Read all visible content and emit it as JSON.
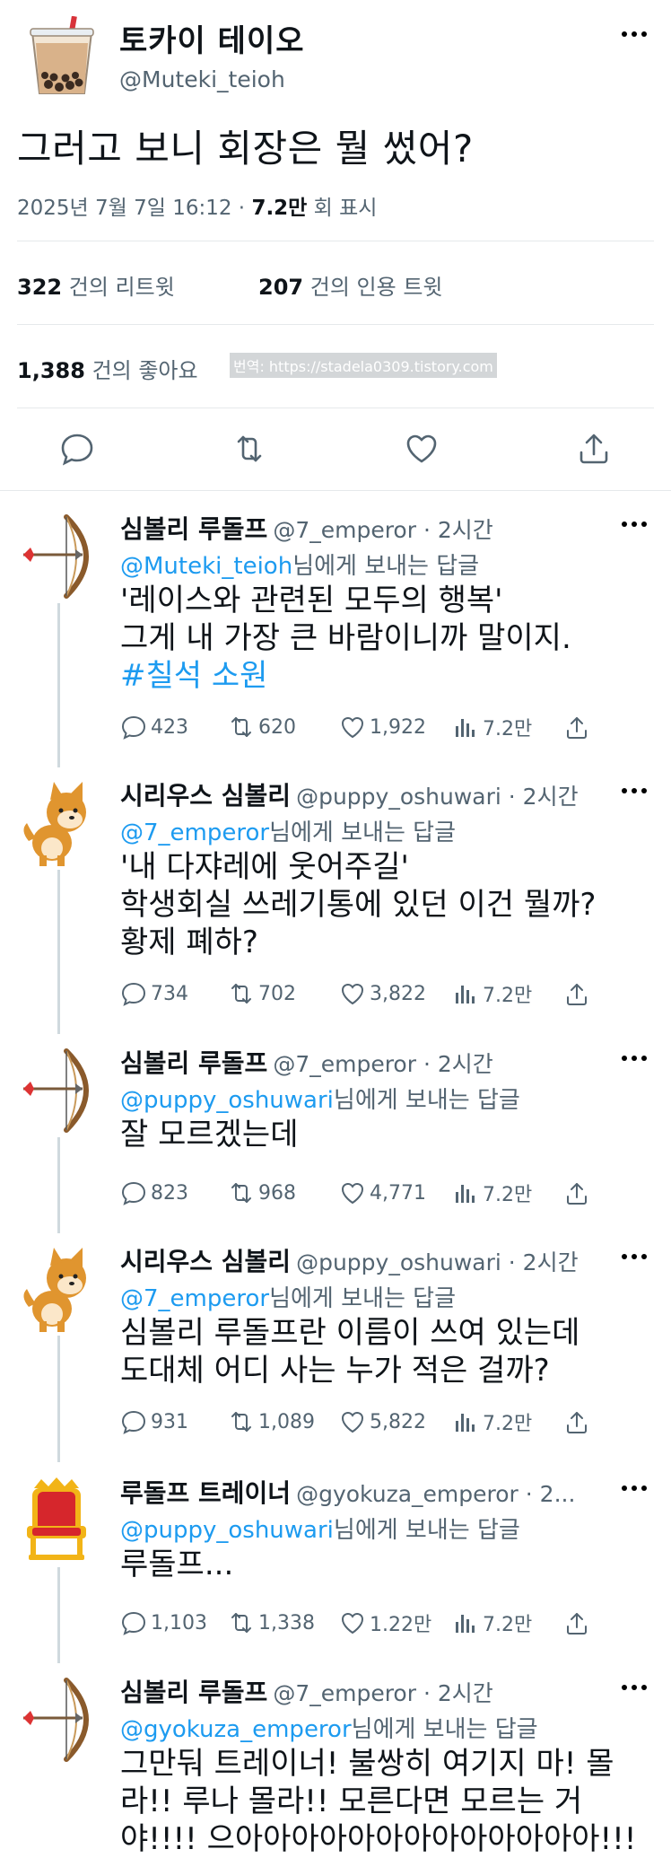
{
  "main_tweet": {
    "name": "토카이 테이오",
    "handle": "@Muteki_teioh",
    "text": "그러고 보니 회장은 뭘 썼어?",
    "date": "2025년 7월 7일  16:12 · ",
    "views": "7.2만",
    "views_suffix": " 회 표시",
    "retweets_count": "322",
    "retweets_label": "건의 리트윗",
    "quotes_count": "207",
    "quotes_label": "건의 인용 트윗",
    "likes_count": "1,388",
    "likes_label": "건의 좋아요",
    "watermark": "번역: https://stadela0309.tistory.com"
  },
  "replies": [
    {
      "name": "심볼리 루돌프",
      "handle": "@7_emperor · 2시간",
      "reply_to": "@Muteki_teioh",
      "reply_suffix": "님에게 보내는 답글",
      "lines": [
        "'레이스와 관련된 모두의 행복'",
        "그게 내 가장 큰 바람이니까 말이지."
      ],
      "hashtag": "#칠석 소원",
      "replies": "423",
      "retweets": "620",
      "likes": "1,922",
      "views": "7.2만",
      "avatar": "bow-arrow-icon"
    },
    {
      "name": "시리우스 심볼리",
      "handle": "@puppy_oshuwari · 2시간",
      "reply_to": "@7_emperor",
      "reply_suffix": "님에게 보내는 답글",
      "lines": [
        "'내 다쟈레에 웃어주길'",
        "학생회실 쓰레기통에 있던 이건 뭘까?",
        "황제 폐하?"
      ],
      "replies": "734",
      "retweets": "702",
      "likes": "3,822",
      "views": "7.2만",
      "avatar": "shiba-dog-icon"
    },
    {
      "name": "심볼리 루돌프",
      "handle": "@7_emperor · 2시간",
      "reply_to": "@puppy_oshuwari",
      "reply_suffix": "님에게 보내는 답글",
      "lines": [
        "잘 모르겠는데"
      ],
      "replies": "823",
      "retweets": "968",
      "likes": "4,771",
      "views": "7.2만",
      "avatar": "bow-arrow-icon"
    },
    {
      "name": "시리우스 심볼리",
      "handle": "@puppy_oshuwari · 2시간",
      "reply_to": "@7_emperor",
      "reply_suffix": "님에게 보내는 답글",
      "lines": [
        "심볼리 루돌프란 이름이 쓰여 있는데",
        "도대체 어디 사는 누가 적은 걸까?"
      ],
      "replies": "931",
      "retweets": "1,089",
      "likes": "5,822",
      "views": "7.2만",
      "avatar": "shiba-dog-icon"
    },
    {
      "name": "루돌프 트레이너",
      "handle": "@gyokuza_emperor · 2...",
      "reply_to": "@puppy_oshuwari",
      "reply_suffix": "님에게 보내는 답글",
      "lines": [
        "루돌프..."
      ],
      "replies": "1,103",
      "retweets": "1,338",
      "likes": "1.22만",
      "views": "7.2만",
      "avatar": "throne-icon"
    },
    {
      "name": "심볼리 루돌프",
      "handle": "@7_emperor · 2시간",
      "reply_to": "@gyokuza_emperor",
      "reply_suffix": "님에게 보내는 답글",
      "lines": [
        "그만둬 트레이너! 불쌍히 여기지 마! 몰",
        "라!! 루나 몰라!! 모른다면 모르는 거",
        "야!!!! 으아아아아아아아아아아아아아!!!"
      ],
      "avatar": "bow-arrow-icon"
    }
  ],
  "colors": {
    "link": "#1d9bf0",
    "muted": "#536471",
    "text": "#0f1419",
    "divider": "#e6e9eb"
  }
}
